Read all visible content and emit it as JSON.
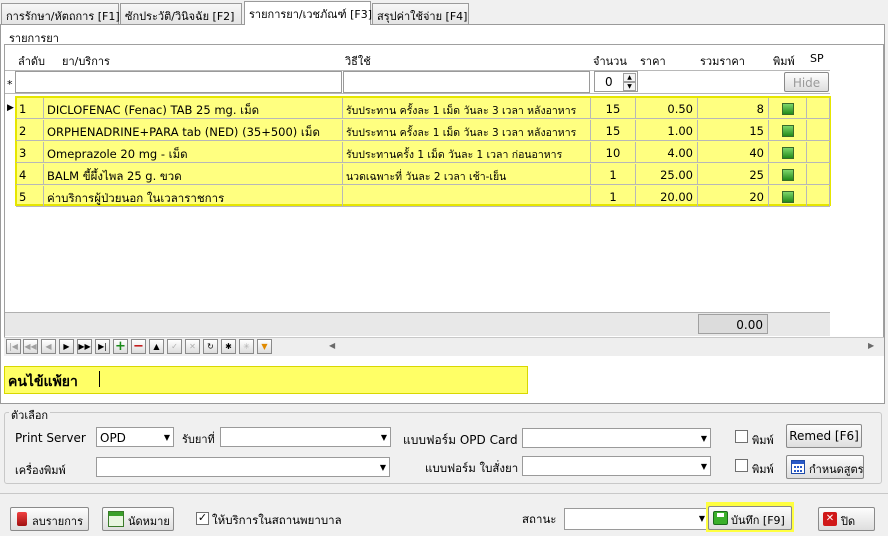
{
  "tabs": [
    "การรักษา/หัตถการ [F1]",
    "ซักประวัติ/วินิจฉัย [F2]",
    "รายการยา/เวชภัณฑ์ [F3]",
    "สรุปค่าใช้จ่าย [F4]"
  ],
  "group_title": "รายการยา",
  "columns": {
    "order": "ลำดับ",
    "item": "ยา/บริการ",
    "usage": "วิธีใช้",
    "qty": "จำนวน",
    "price": "ราคา",
    "total": "รวมราคา",
    "print": "พิมพ์",
    "sp": "SP"
  },
  "new_row": {
    "marker": "*",
    "qty_value": "0",
    "hide_label": "Hide"
  },
  "rows": [
    {
      "no": "1",
      "item": "DICLOFENAC (Fenac) TAB 25 mg. เม็ด",
      "usage": "รับประทาน ครั้งละ   1   เม็ด วันละ 3 เวลา หลังอาหาร",
      "qty": "15",
      "price": "0.50",
      "total": "8",
      "current": "true"
    },
    {
      "no": "2",
      "item": "ORPHENADRINE+PARA tab (NED) (35+500) เม็ด",
      "usage": "รับประทาน ครั้งละ   1   เม็ด วันละ 3 เวลา หลังอาหาร",
      "qty": "15",
      "price": "1.00",
      "total": "15",
      "current": "false"
    },
    {
      "no": "3",
      "item": "Omeprazole 20 mg - เม็ด",
      "usage": "รับประทานครั้ง     1       เม็ด วันละ 1 เวลา ก่อนอาหาร",
      "qty": "10",
      "price": "4.00",
      "total": "40",
      "current": "false"
    },
    {
      "no": "4",
      "item": "BALM ขี้ผึ้งไพล 25 g. ขวด",
      "usage": "นวดเฉพาะที่ วันละ 2 เวลา เช้า-เย็น",
      "qty": "1",
      "price": "25.00",
      "total": "25",
      "current": "false"
    },
    {
      "no": "5",
      "item": "ค่าบริการผู้ป่วยนอก ในเวลาราชการ",
      "usage": "",
      "qty": "1",
      "price": "20.00",
      "total": "20",
      "current": "false"
    }
  ],
  "footer_total": "0.00",
  "allergy_label": "คนไข้แพ้ยา",
  "allergy_value": "",
  "options": {
    "title": "ตัวเลือก",
    "print_server_label": "Print Server",
    "print_server_value": "OPD",
    "receive_at_label": "รับยาที่",
    "opd_card_form_label": "แบบฟอร์ม OPD Card",
    "printer_label": "เครื่องพิมพ์",
    "rx_form_label": "แบบฟอร์ม ใบสั่งยา",
    "print_label_1": "พิมพ์",
    "print_label_2": "พิมพ์",
    "remed_label": "Remed [F6]",
    "formula_label": "กำหนดสูตร"
  },
  "bottom": {
    "delete_label": "ลบรายการ",
    "appointment_label": "นัดหมาย",
    "in_hospital_label": "ให้บริการในสถานพยาบาล",
    "status_label": "สถานะ",
    "save_label": "บันทึก [F9]",
    "close_label": "ปิด"
  }
}
